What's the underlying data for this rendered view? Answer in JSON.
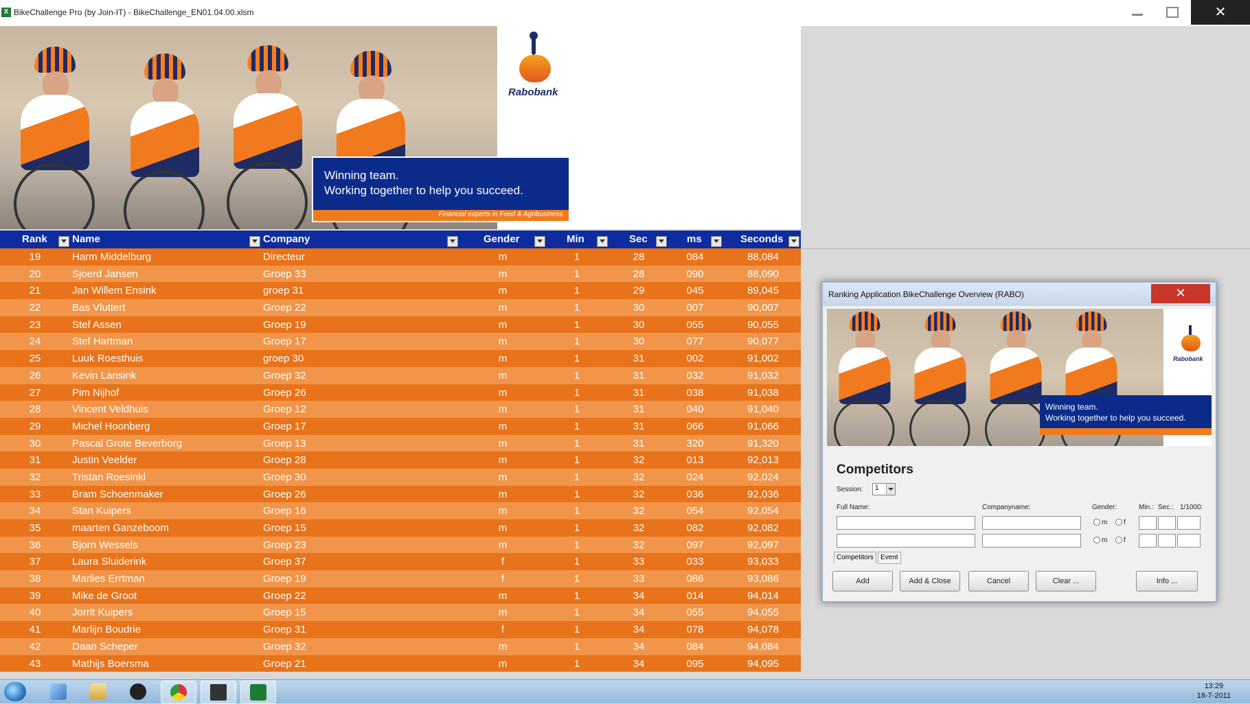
{
  "window": {
    "title": "BikeChallenge Pro (by Join-IT) - BikeChallenge_EN01.04.00.xlsm",
    "close_label": "✕"
  },
  "banner": {
    "logo_text": "Rabobank",
    "slogan_line1": "Winning team.",
    "slogan_line2": "Working together to help you succeed.",
    "tagline": "Financial experts in Food & Agribusiness."
  },
  "table": {
    "columns": [
      "Rank",
      "Name",
      "Company",
      "Gender",
      "Min",
      "Sec",
      "ms",
      "Seconds"
    ],
    "rows": [
      [
        "19",
        "Harm Middelburg",
        "Directeur",
        "m",
        "1",
        "28",
        "084",
        "88,084"
      ],
      [
        "20",
        "Sjoerd Jansen",
        "Groep 33",
        "m",
        "1",
        "28",
        "090",
        "88,090"
      ],
      [
        "21",
        "Jan Willem Ensink",
        "groep 31",
        "m",
        "1",
        "29",
        "045",
        "89,045"
      ],
      [
        "22",
        "Bas Vluttert",
        "Groep 22",
        "m",
        "1",
        "30",
        "007",
        "90,007"
      ],
      [
        "23",
        "Stef Assen",
        "Groep 19",
        "m",
        "1",
        "30",
        "055",
        "90,055"
      ],
      [
        "24",
        "Stef Hartman",
        "Groep 17",
        "m",
        "1",
        "30",
        "077",
        "90,077"
      ],
      [
        "25",
        "Luuk Roesthuis",
        "groep 30",
        "m",
        "1",
        "31",
        "002",
        "91,002"
      ],
      [
        "26",
        "Kevin Lansink",
        "Groep 32",
        "m",
        "1",
        "31",
        "032",
        "91,032"
      ],
      [
        "27",
        "Pim Nijhof",
        "Groep 26",
        "m",
        "1",
        "31",
        "038",
        "91,038"
      ],
      [
        "28",
        "Vincent Veldhuis",
        "Groep 12",
        "m",
        "1",
        "31",
        "040",
        "91,040"
      ],
      [
        "29",
        "Michel Hoonberg",
        "Groep 17",
        "m",
        "1",
        "31",
        "066",
        "91,066"
      ],
      [
        "30",
        "Pascal Grote Beverborg",
        "Groep 13",
        "m",
        "1",
        "31",
        "320",
        "91,320"
      ],
      [
        "31",
        "Justin Veelder",
        "Groep 28",
        "m",
        "1",
        "32",
        "013",
        "92,013"
      ],
      [
        "32",
        "Tristan Roesinkl",
        "Groep 30",
        "m",
        "1",
        "32",
        "024",
        "92,024"
      ],
      [
        "33",
        "Bram Schoenmaker",
        "Groep 26",
        "m",
        "1",
        "32",
        "036",
        "92,036"
      ],
      [
        "34",
        "Stan Kuipers",
        "Groep 16",
        "m",
        "1",
        "32",
        "054",
        "92,054"
      ],
      [
        "35",
        "maarten Ganzeboom",
        "Groep 15",
        "m",
        "1",
        "32",
        "082",
        "92,082"
      ],
      [
        "36",
        "Bjorn Wessels",
        "Groep 23",
        "m",
        "1",
        "32",
        "097",
        "92,097"
      ],
      [
        "37",
        "Laura Sluiderink",
        "Groep 37",
        "f",
        "1",
        "33",
        "033",
        "93,033"
      ],
      [
        "38",
        "Marlies Errtman",
        "Groep 19",
        "f",
        "1",
        "33",
        "086",
        "93,086"
      ],
      [
        "39",
        "Mike de Groot",
        "Groep 22",
        "m",
        "1",
        "34",
        "014",
        "94,014"
      ],
      [
        "40",
        "Jorrit Kuipers",
        "Groep 15",
        "m",
        "1",
        "34",
        "055",
        "94,055"
      ],
      [
        "41",
        "Marlijn Boudrie",
        "Groep 31",
        "f",
        "1",
        "34",
        "078",
        "94,078"
      ],
      [
        "42",
        "Daan Scheper",
        "Groep 32",
        "m",
        "1",
        "34",
        "084",
        "94,084"
      ],
      [
        "43",
        "Mathijs Boersma",
        "Groep 21",
        "m",
        "1",
        "34",
        "095",
        "94,095"
      ]
    ]
  },
  "dialog": {
    "title": "Ranking Application BikeChallenge Overview (RABO)",
    "close_label": "✕",
    "logo_text": "Rabobank",
    "slogan_line1": "Winning team.",
    "slogan_line2": "Working together to help you succeed.",
    "heading": "Competitors",
    "session_label": "Session:",
    "session_value": "1",
    "fullname_label": "Full Name:",
    "company_label": "Companyname:",
    "gender_label": "Gender:",
    "gender_m": "m",
    "gender_f": "f",
    "min_label": "Min.:",
    "sec_label": "Sec.:",
    "ms_label": "1/1000:",
    "tabs": [
      "Competitors",
      "Event"
    ],
    "buttons": [
      "Add",
      "Add & Close",
      "Cancel",
      "Clear ...",
      "Info ..."
    ]
  },
  "taskbar": {
    "time": "13:29",
    "date": "18-7-2011"
  }
}
